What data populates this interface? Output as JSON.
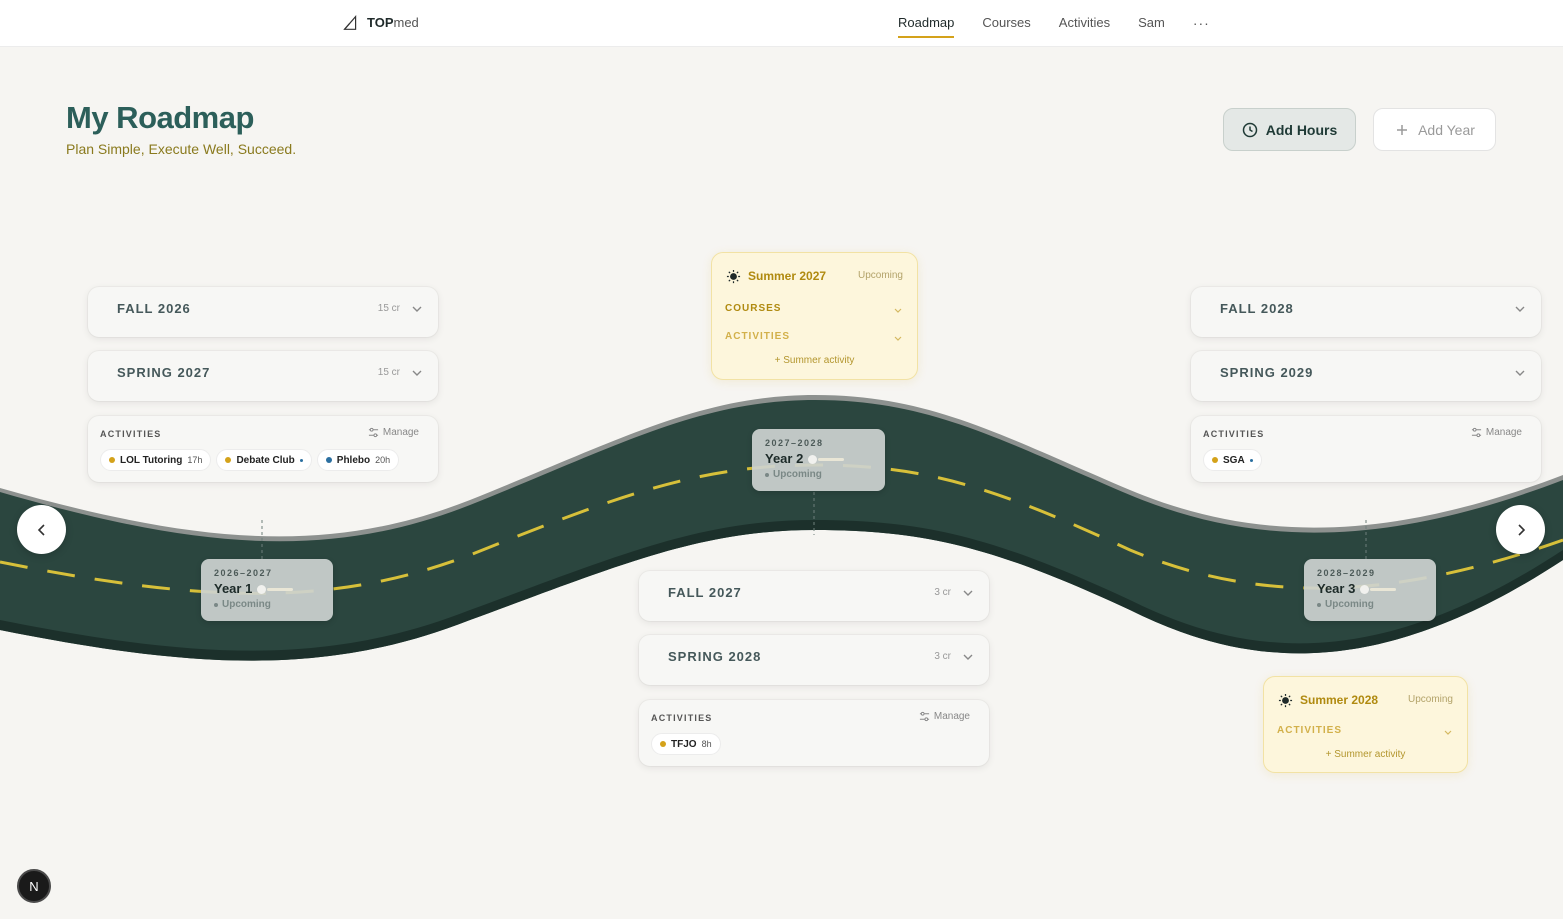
{
  "nav": {
    "brand_bold": "TOP",
    "brand_light": "med",
    "links": [
      "Roadmap",
      "Courses",
      "Activities",
      "Sam"
    ],
    "active": "Roadmap",
    "more": "···"
  },
  "header": {
    "title": "My Roadmap",
    "subtitle": "Plan Simple, Execute Well, Succeed."
  },
  "actions": {
    "add_hours": "Add Hours",
    "add_year": "Add Year"
  },
  "years": [
    {
      "range": "2026–2027",
      "name": "Year 1",
      "status": "Upcoming",
      "terms": [
        {
          "name": "FALL 2026",
          "credits": "15 cr"
        },
        {
          "name": "SPRING 2027",
          "credits": "15 cr"
        }
      ],
      "activities": {
        "heading": "ACTIVITIES",
        "manage": "Manage",
        "chips": [
          {
            "name": "LOL Tutoring",
            "hours": "17h",
            "color": "#d4a21a"
          },
          {
            "name": "Debate Club",
            "hours": "",
            "color": "#d4a21a"
          },
          {
            "name": "Phlebo",
            "hours": "20h",
            "color": "#2b6fa0"
          }
        ]
      }
    },
    {
      "range": "2027–2028",
      "name": "Year 2",
      "status": "Upcoming",
      "terms": [
        {
          "name": "FALL 2027",
          "credits": "3 cr"
        },
        {
          "name": "SPRING 2028",
          "credits": "3 cr"
        }
      ],
      "activities": {
        "heading": "ACTIVITIES",
        "manage": "Manage",
        "chips": [
          {
            "name": "TFJO",
            "hours": "8h",
            "color": "#d4a21a"
          }
        ]
      }
    },
    {
      "range": "2028–2029",
      "name": "Year 3",
      "status": "Upcoming",
      "terms": [
        {
          "name": "FALL 2028",
          "credits": ""
        },
        {
          "name": "SPRING 2029",
          "credits": ""
        }
      ],
      "activities": {
        "heading": "ACTIVITIES",
        "manage": "Manage",
        "chips": [
          {
            "name": "SGA",
            "hours": "",
            "color": "#d4a21a"
          }
        ]
      }
    }
  ],
  "summers": [
    {
      "title": "Summer 2027",
      "status": "Upcoming",
      "courses": "COURSES",
      "activities": "ACTIVITIES",
      "add": "+ Summer activity"
    },
    {
      "title": "Summer 2028",
      "status": "Upcoming",
      "activities": "ACTIVITIES",
      "add": "+ Summer activity"
    }
  ],
  "colors": {
    "road": "#2b463f",
    "road_edge": "#1c302b",
    "shoulder": "#8d918f",
    "lane": "#d7c03a",
    "accent": "#d4a21a",
    "title": "#2c5f5a"
  },
  "misc": {
    "n_badge": "N"
  }
}
